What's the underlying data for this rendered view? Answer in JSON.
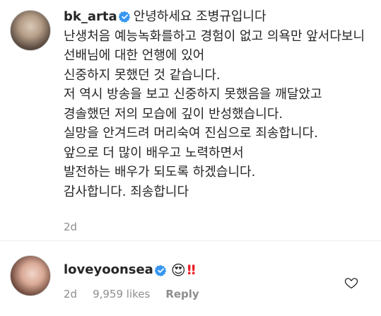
{
  "comments": [
    {
      "username": "bk_arta",
      "text": "안녕하세요 조병규입니다\n난생처음 예능녹화를하고 경험이 없고 의욕만 앞서다보니\n선배님에 대한 언행에 있어\n신중하지 못했던 것 같습니다.\n저 역시 방송을 보고 신중하지 못했음을 깨달았고\n경솔했던 저의 모습에 깊이 반성했습니다.\n실망을 안겨드려 머리숙여 진심으로 죄송합니다.\n앞으로 더 많이 배우고 노력하면서\n발전하는 배우가 되도록 하겠습니다.\n감사합니다. 죄송합니다",
      "time": "2d"
    },
    {
      "username": "loveyoonsea",
      "emoji": "😍",
      "exclamation": "‼",
      "time": "2d",
      "likes": "9,959 likes",
      "reply": "Reply"
    }
  ],
  "icons": {
    "verified": "verified-badge-icon",
    "like": "heart-icon"
  },
  "colors": {
    "verified": "#3897f0",
    "meta_text": "#8e8e8e",
    "exclamation": "#ed1c24"
  }
}
